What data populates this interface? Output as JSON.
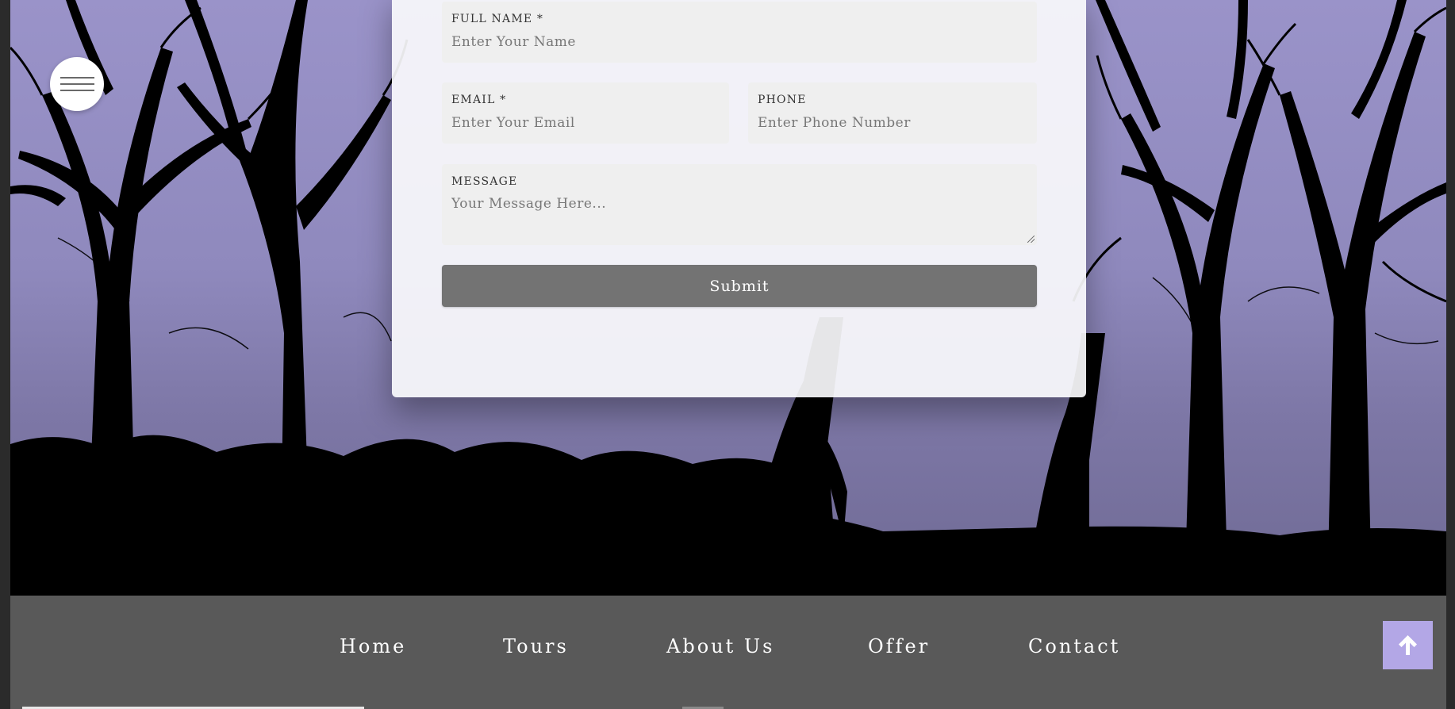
{
  "form": {
    "full_name": {
      "label": "FULL NAME *",
      "placeholder": "Enter Your Name",
      "value": ""
    },
    "email": {
      "label": "EMAIL *",
      "placeholder": "Enter Your Email",
      "value": ""
    },
    "phone": {
      "label": "PHONE",
      "placeholder": "Enter Phone Number",
      "value": ""
    },
    "message": {
      "label": "MESSAGE",
      "placeholder": "Your Message Here...",
      "value": ""
    },
    "submit_label": "Submit"
  },
  "menu": {
    "icon": "hamburger-icon"
  },
  "footer": {
    "nav": [
      {
        "label": "Home"
      },
      {
        "label": "Tours"
      },
      {
        "label": "About Us"
      },
      {
        "label": "Offer"
      },
      {
        "label": "Contact"
      }
    ]
  },
  "scroll_top": {
    "icon": "arrow-up-icon"
  },
  "colors": {
    "sky": "#9a93c9",
    "footer": "#595959",
    "submit": "#737373",
    "scroll_top": "#b3a7e6",
    "field": "#efefef"
  }
}
